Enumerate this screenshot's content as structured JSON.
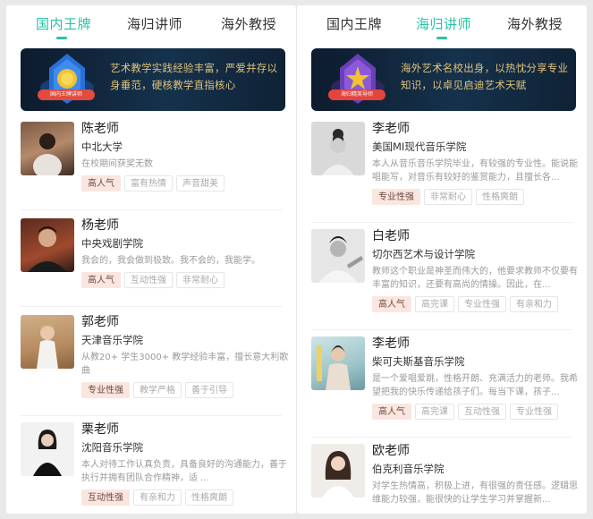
{
  "left": {
    "tabs": [
      "国内王牌",
      "海归讲师",
      "海外教授"
    ],
    "active_tab": 0,
    "banner": {
      "text": "艺术教学实践经验丰富，严爱并存以身垂范，硬核教学直指核心",
      "medal_label": "国内王牌讲师"
    },
    "teachers": [
      {
        "name": "陈老师",
        "school": "中北大学",
        "desc": "在校期间获奖无数",
        "tags": [
          "高人气",
          "富有热情",
          "声音甜美"
        ]
      },
      {
        "name": "杨老师",
        "school": "中央戏剧学院",
        "desc": "我会的，我会做到极致。我不会的，我能学。",
        "tags": [
          "高人气",
          "互动性强",
          "非常耐心"
        ]
      },
      {
        "name": "郭老师",
        "school": "天津音乐学院",
        "desc": "从教20+ 学生3000+ 教学经验丰富，擅长意大利歌曲",
        "tags": [
          "专业性强",
          "教学严格",
          "善于引导"
        ]
      },
      {
        "name": "栗老师",
        "school": "沈阳音乐学院",
        "desc": "本人对待工作认真负责，具备良好的沟通能力，善于执行并拥有团队合作精神，适 ...",
        "tags": [
          "互动性强",
          "有亲和力",
          "性格爽朗"
        ]
      }
    ]
  },
  "right": {
    "tabs": [
      "国内王牌",
      "海归讲师",
      "海外教授"
    ],
    "active_tab": 1,
    "banner": {
      "text": "海外艺术名校出身，以热忱分享专业知识，以卓见启迪艺术天赋",
      "medal_label": "海归精英导师"
    },
    "teachers": [
      {
        "name": "李老师",
        "school": "美国MI现代音乐学院",
        "desc": "本人从音乐音乐学院毕业，有较强的专业性。能说能唱能写，对音乐有较好的鉴赏能力，且擅长各...",
        "tags": [
          "专业性强",
          "非常耐心",
          "性格爽朗"
        ]
      },
      {
        "name": "白老师",
        "school": "切尔西艺术与设计学院",
        "desc": "教师这个职业是神圣而伟大的，他要求教师不仅要有丰富的知识，还要有高尚的情操。因此，在...",
        "tags": [
          "高人气",
          "高完课",
          "专业性强",
          "有亲和力"
        ]
      },
      {
        "name": "李老师",
        "school": "柴可夫斯基音乐学院",
        "desc": "是一个爱唱爱跳，性格开朗、充满活力的老师。我希望把我的快乐传递给孩子们。每当下课，孩子...",
        "tags": [
          "高人气",
          "高完课",
          "互动性强",
          "专业性强"
        ]
      },
      {
        "name": "欧老师",
        "school": "伯克利音乐学院",
        "desc": "对学生热情高，积极上进，有很强的责任感。逻辑思维能力较强，能很快的让学生学习并掌握新...",
        "tags": []
      }
    ]
  },
  "colors": {
    "accent": "#29c3a7",
    "highlight_tag_bg": "#fbe6df",
    "banner_text": "#e0c27a"
  }
}
